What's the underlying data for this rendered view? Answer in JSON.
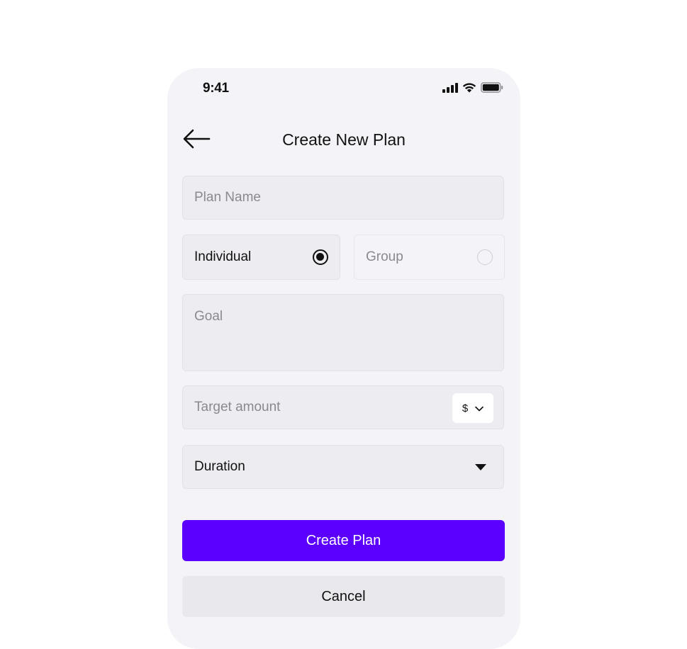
{
  "status_bar": {
    "time": "9:41",
    "icons": [
      "cellular-signal-icon",
      "wifi-icon",
      "battery-icon"
    ]
  },
  "header": {
    "title": "Create New Plan",
    "back_icon": "arrow-left-icon"
  },
  "form": {
    "plan_name": {
      "value": "",
      "placeholder": "Plan Name"
    },
    "plan_type": {
      "options": [
        {
          "label": "Individual",
          "selected": true
        },
        {
          "label": "Group",
          "selected": false
        }
      ]
    },
    "goal": {
      "value": "",
      "placeholder": "Goal"
    },
    "target_amount": {
      "value": "",
      "placeholder": "Target amount",
      "currency": "$"
    },
    "duration": {
      "selected": "Duration"
    }
  },
  "actions": {
    "create_label": "Create Plan",
    "cancel_label": "Cancel"
  },
  "colors": {
    "primary": "#5b00ff",
    "surface": "#f4f3f8",
    "field": "#edecf1",
    "text": "#111111",
    "placeholder": "#8a8990"
  }
}
